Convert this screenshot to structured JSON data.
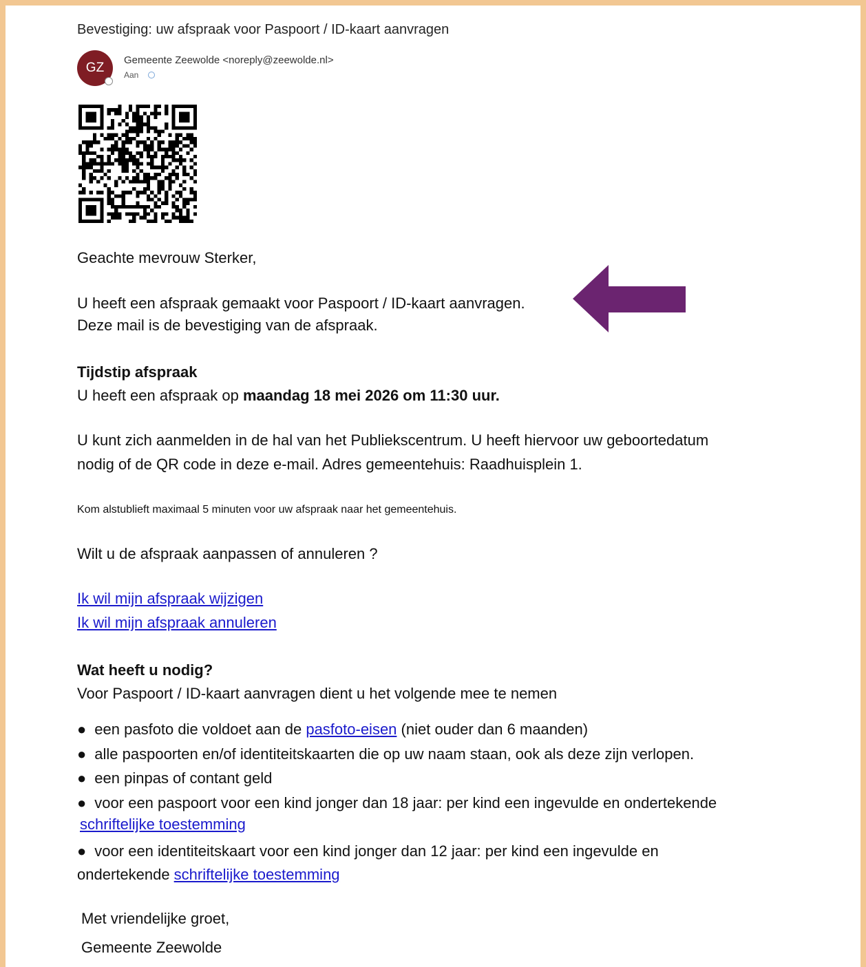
{
  "email": {
    "subject": "Bevestiging: uw afspraak voor Paspoort / ID-kaart aanvragen",
    "sender": "Gemeente Zeewolde <noreply@zeewolde.nl>",
    "avatar_initials": "GZ",
    "to_label": "Aan",
    "avatar_color": "#7f1d24",
    "arrow_color": "#6b2470",
    "link_color": "#1a1acc"
  },
  "body": {
    "greeting": "Geachte mevrouw Sterker,",
    "intro_line1": "U heeft een afspraak gemaakt voor Paspoort / ID-kaart aanvragen.",
    "intro_line2": "Deze mail is de bevestiging van de afspraak.",
    "time_heading": "Tijdstip afspraak",
    "time_prefix": "U heeft een afspraak op ",
    "time_value": "maandag 18 mei 2026 om 11:30 uur.",
    "checkin_line1": "U kunt zich aanmelden in de hal van het Publiekscentrum. U heeft hiervoor uw geboortedatum",
    "checkin_line2": "nodig of de QR code in deze e-mail. Adres gemeentehuis: Raadhuisplein 1.",
    "early_note": "Kom alstublieft maximaal 5 minuten voor uw afspraak naar het gemeentehuis.",
    "change_question": "Wilt u de afspraak aanpassen of annuleren ?",
    "link_change": "Ik wil mijn afspraak wijzigen",
    "link_cancel": "Ik wil mijn afspraak annuleren",
    "needs_heading": "Wat heeft u nodig?",
    "needs_intro": "Voor Paspoort / ID-kaart aanvragen dient u het volgende mee te nemen",
    "bullet1_prefix": "een pasfoto die voldoet aan de ",
    "bullet1_link": "pasfoto-eisen",
    "bullet1_suffix": " (niet ouder dan 6 maanden)",
    "bullet2": "alle paspoorten en/of identiteitskaarten die op uw naam staan, ook als deze zijn verlopen.",
    "bullet3": "een pinpas of contant geld",
    "bullet4_text": "voor een paspoort voor een kind jonger dan 18 jaar: per kind een ingevulde en ondertekende",
    "bullet4_link": "schriftelijke toestemming",
    "bullet5_text": "voor een identiteitskaart voor een kind jonger dan 12 jaar: per kind een ingevulde en",
    "bullet5_cont": "ondertekende ",
    "bullet5_link": "schriftelijke toestemming",
    "closing": "Met vriendelijke groet,",
    "signature": "Gemeente Zeewolde"
  }
}
